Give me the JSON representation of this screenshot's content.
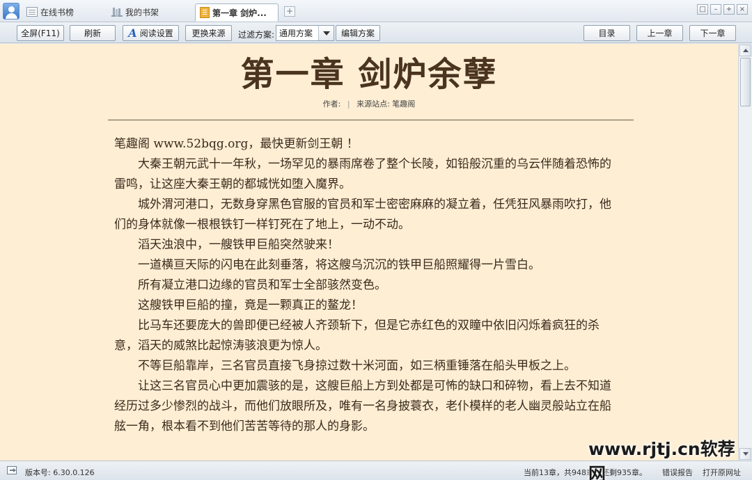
{
  "tabs": [
    {
      "label": "在线书榜",
      "icon": "list-icon"
    },
    {
      "label": "我的书架",
      "icon": "bookshelf-icon"
    },
    {
      "label": "第一章 剑炉...",
      "icon": "book-icon",
      "active": true
    }
  ],
  "add_tab_label": "+",
  "window_controls": [
    "□",
    "–",
    "+",
    "×"
  ],
  "toolbar": {
    "fullscreen_label": "全屏(F11)",
    "refresh_label": "刷新",
    "reading_settings_label": "阅读设置",
    "change_source_label": "更换来源",
    "filter_label": "过滤方案:",
    "filter_value": "通用方案",
    "edit_scheme_label": "编辑方案",
    "toc_label": "目录",
    "prev_chapter_label": "上一章",
    "next_chapter_label": "下一章"
  },
  "chapter": {
    "title": "第一章 剑炉余孽",
    "author_label": "作者:",
    "separator": "|",
    "source_label": "来源站点: 笔趣阁",
    "paragraphs": [
      "笔趣阁 www.52bqg.org，最快更新剑王朝 ！",
      "大秦王朝元武十一年秋，一场罕见的暴雨席卷了整个长陵，如铅般沉重的乌云伴随着恐怖的雷鸣，让这座大秦王朝的都城恍如堕入魔界。",
      "城外渭河港口，无数身穿黑色官服的官员和军士密密麻麻的凝立着，任凭狂风暴雨吹打，他们的身体就像一根根铁钉一样钉死在了地上，一动不动。",
      "滔天浊浪中，一艘铁甲巨船突然驶来！",
      "一道横亘天际的闪电在此刻垂落，将这艘乌沉沉的铁甲巨船照耀得一片雪白。",
      "所有凝立港口边缘的官员和军士全部骇然变色。",
      "这艘铁甲巨船的撞，竟是一颗真正的鳌龙！",
      "比马车还要庞大的兽即便已经被人齐颈斩下，但是它赤红色的双瞳中依旧闪烁着疯狂的杀意，滔天的威煞比起惊涛骇浪更为惊人。",
      "不等巨船靠岸，三名官员直接飞身掠过数十米河面，如三柄重锤落在船头甲板之上。",
      "让这三名官员心中更加震骇的是，这艘巨船上方到处都是可怖的缺口和碎物，看上去不知道经历过多少惨烈的战斗，而他们放眼所及，唯有一名身披蓑衣，老仆模样的老人幽灵般站立在船舷一角，根本看不到他们苦苦等待的那人的身影。"
    ]
  },
  "status": {
    "version": "版本号: 6.30.0.126",
    "progress": "当前13章，共948章，还剩935章。",
    "report_error": "错误报告",
    "open_original": "打开原网址"
  },
  "watermark": "www.rjtj.cn软荐网",
  "colors": {
    "page_background": "#fdeed4",
    "text": "#3a2a1c",
    "title": "#4a3420",
    "chrome": "#dfe6ee"
  }
}
